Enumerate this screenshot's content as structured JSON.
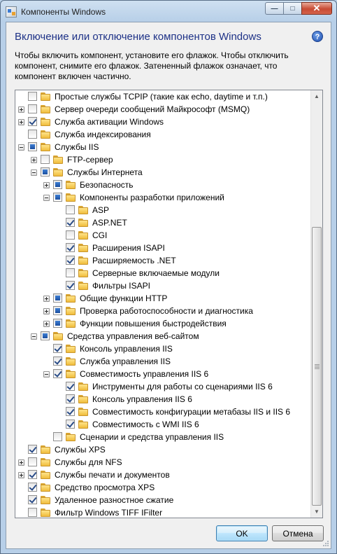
{
  "window": {
    "title": "Компоненты Windows"
  },
  "header": {
    "heading": "Включение или отключение компонентов Windows",
    "description": "Чтобы включить компонент, установите его флажок. Чтобы отключить компонент, снимите его флажок. Затененный флажок означает, что компонент включен частично."
  },
  "tree": {
    "items": [
      {
        "label": "Простые службы TCPIP (такие как echo, daytime и т.п.)",
        "level": 0,
        "expander": "none",
        "state": "unchecked"
      },
      {
        "label": "Сервер очереди сообщений Майкрософт (MSMQ)",
        "level": 0,
        "expander": "plus",
        "state": "unchecked"
      },
      {
        "label": "Служба активации Windows",
        "level": 0,
        "expander": "plus",
        "state": "checked"
      },
      {
        "label": "Служба индексирования",
        "level": 0,
        "expander": "none",
        "state": "unchecked"
      },
      {
        "label": "Службы IIS",
        "level": 0,
        "expander": "minus",
        "state": "partial"
      },
      {
        "label": "FTP-сервер",
        "level": 1,
        "expander": "plus",
        "state": "unchecked"
      },
      {
        "label": "Службы Интернета",
        "level": 1,
        "expander": "minus",
        "state": "partial"
      },
      {
        "label": "Безопасность",
        "level": 2,
        "expander": "plus",
        "state": "partial"
      },
      {
        "label": "Компоненты разработки приложений",
        "level": 2,
        "expander": "minus",
        "state": "partial"
      },
      {
        "label": "ASP",
        "level": 3,
        "expander": "none",
        "state": "unchecked"
      },
      {
        "label": "ASP.NET",
        "level": 3,
        "expander": "none",
        "state": "checked"
      },
      {
        "label": "CGI",
        "level": 3,
        "expander": "none",
        "state": "unchecked"
      },
      {
        "label": "Расширения ISAPI",
        "level": 3,
        "expander": "none",
        "state": "checked"
      },
      {
        "label": "Расширяемость .NET",
        "level": 3,
        "expander": "none",
        "state": "checked"
      },
      {
        "label": "Серверные включаемые модули",
        "level": 3,
        "expander": "none",
        "state": "unchecked"
      },
      {
        "label": "Фильтры ISAPI",
        "level": 3,
        "expander": "none",
        "state": "checked"
      },
      {
        "label": "Общие функции HTTP",
        "level": 2,
        "expander": "plus",
        "state": "partial"
      },
      {
        "label": "Проверка работоспособности и диагностика",
        "level": 2,
        "expander": "plus",
        "state": "partial"
      },
      {
        "label": "Функции повышения быстродействия",
        "level": 2,
        "expander": "plus",
        "state": "partial"
      },
      {
        "label": "Средства управления веб-сайтом",
        "level": 1,
        "expander": "minus",
        "state": "partial"
      },
      {
        "label": "Консоль управления IIS",
        "level": 2,
        "expander": "none",
        "state": "checked"
      },
      {
        "label": "Служба управления IIS",
        "level": 2,
        "expander": "none",
        "state": "checked"
      },
      {
        "label": "Совместимость управления IIS 6",
        "level": 2,
        "expander": "minus",
        "state": "checked"
      },
      {
        "label": "Инструменты для работы со сценариями IIS 6",
        "level": 3,
        "expander": "none",
        "state": "checked"
      },
      {
        "label": "Консоль управления IIS 6",
        "level": 3,
        "expander": "none",
        "state": "checked"
      },
      {
        "label": "Совместимость конфигурации метабазы IIS и IIS 6",
        "level": 3,
        "expander": "none",
        "state": "checked"
      },
      {
        "label": "Совместимость с WMI IIS 6",
        "level": 3,
        "expander": "none",
        "state": "checked"
      },
      {
        "label": "Сценарии и средства управления IIS",
        "level": 2,
        "expander": "none",
        "state": "unchecked"
      },
      {
        "label": "Службы XPS",
        "level": 0,
        "expander": "none",
        "state": "checked"
      },
      {
        "label": "Службы для NFS",
        "level": 0,
        "expander": "plus",
        "state": "unchecked"
      },
      {
        "label": "Службы печати и документов",
        "level": 0,
        "expander": "plus",
        "state": "checked"
      },
      {
        "label": "Средство просмотра XPS",
        "level": 0,
        "expander": "none",
        "state": "checked"
      },
      {
        "label": "Удаленное разностное сжатие",
        "level": 0,
        "expander": "none",
        "state": "checked"
      },
      {
        "label": "Фильтр Windows TIFF IFilter",
        "level": 0,
        "expander": "none",
        "state": "unchecked"
      }
    ]
  },
  "buttons": {
    "ok": "OK",
    "cancel": "Отмена"
  },
  "colors": {
    "heading": "#1e3287",
    "accent": "#3c7fb1"
  }
}
